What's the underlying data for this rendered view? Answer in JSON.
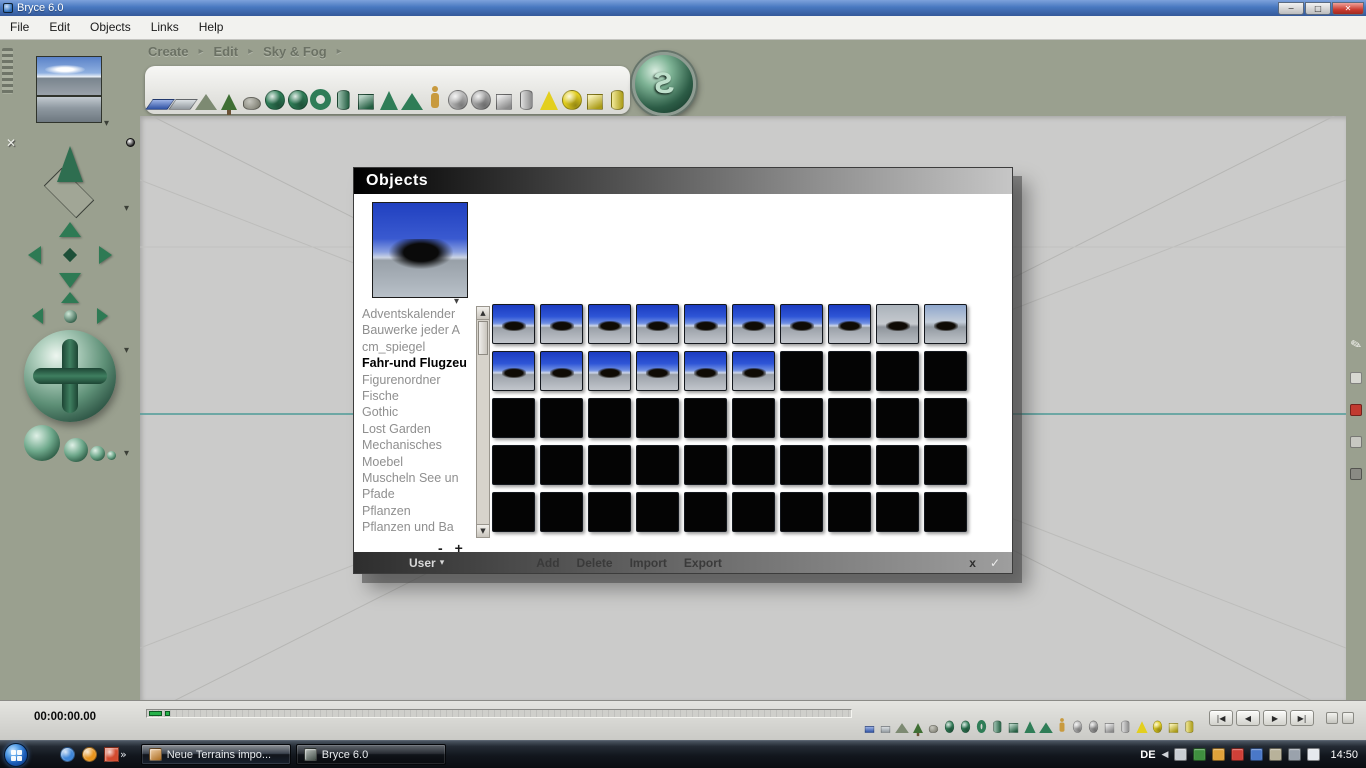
{
  "chrome": {
    "title": "Bryce 6.0",
    "window_buttons": [
      "−",
      "□",
      "✕"
    ],
    "menu": [
      "File",
      "Edit",
      "Objects",
      "Links",
      "Help"
    ],
    "mode_tabs": [
      "Create",
      "Edit",
      "Sky & Fog"
    ]
  },
  "glyphs": {
    "tab_arrow": "▸",
    "dropdown": "▾",
    "scroll_up": "▲",
    "scroll_down": "▼",
    "chevron_more": "»",
    "tray_chevron": "◀",
    "clear": "✕",
    "logo": "S"
  },
  "palette": {
    "icons": [
      {
        "name": "water-plane",
        "shape": "tile",
        "color": "#3a66cc"
      },
      {
        "name": "cloud-plane",
        "shape": "tile",
        "color": "#b6bfc6"
      },
      {
        "name": "terrain",
        "shape": "mountain",
        "color": "#7d8a72"
      },
      {
        "name": "tree",
        "shape": "tree",
        "color": "#3f6f34"
      },
      {
        "name": "rock",
        "shape": "rock",
        "color": "#8d8d7d"
      },
      {
        "name": "metaball",
        "shape": "sphere",
        "color": "#2f7d57"
      },
      {
        "name": "sphere",
        "shape": "sphere",
        "color": "#2f7d57"
      },
      {
        "name": "torus",
        "shape": "torus",
        "color": "#2f7d57"
      },
      {
        "name": "cylinder",
        "shape": "cylinder",
        "color": "#2f7d57"
      },
      {
        "name": "cube",
        "shape": "cube",
        "color": "#2f7d57"
      },
      {
        "name": "cone",
        "shape": "cone",
        "color": "#2f7d57"
      },
      {
        "name": "pyramid",
        "shape": "pyramid",
        "color": "#2f7d57"
      },
      {
        "name": "figure",
        "shape": "figure",
        "color": "#c89a3e"
      },
      {
        "name": "light-sphere",
        "shape": "sphere",
        "color": "#b9b9b9"
      },
      {
        "name": "light-dome",
        "shape": "sphere",
        "color": "#a6a6a6"
      },
      {
        "name": "light-cube",
        "shape": "cube",
        "color": "#b9b9b9"
      },
      {
        "name": "light-cylinder",
        "shape": "cylinder",
        "color": "#b9b9b9"
      },
      {
        "name": "spot-light",
        "shape": "cone",
        "color": "#e3cf1e"
      },
      {
        "name": "radial-light",
        "shape": "sphere",
        "color": "#e3cf1e"
      },
      {
        "name": "square-spot-light",
        "shape": "cube",
        "color": "#e3cf1e"
      },
      {
        "name": "parallel-light",
        "shape": "cylinder",
        "color": "#e3cf1e"
      }
    ]
  },
  "dialog": {
    "title": "Objects",
    "categories": [
      "Adventskalender",
      "Bauwerke jeder A",
      "cm_spiegel",
      "Fahr-und Flugzeu",
      "Figurenordner",
      "Fische",
      "Gothic",
      "Lost  Garden",
      "Mechanisches",
      "Moebel",
      "Muscheln See un",
      "Pfade",
      "Pflanzen",
      "Pflanzen und  Ba"
    ],
    "selected_index": 3,
    "zoom": {
      "minus": "-",
      "plus": "+"
    },
    "grid": {
      "cols": 10,
      "rows": [
        [
          {
            "n": "fighter-plane",
            "v": "sky"
          },
          {
            "n": "covered-wagon",
            "v": "sky"
          },
          {
            "n": "vintage-car",
            "v": "sky"
          },
          {
            "n": "hot-air-balloon",
            "v": "sky"
          },
          {
            "n": "barrel",
            "v": "sky"
          },
          {
            "n": "handcart",
            "v": "sky"
          },
          {
            "n": "seaplane",
            "v": "sky"
          },
          {
            "n": "sports-car",
            "v": "sky"
          },
          {
            "n": "gray-scene",
            "v": "gray"
          },
          {
            "n": "coast-scene",
            "v": "grayblue"
          }
        ],
        [
          {
            "n": "stagecoach",
            "v": "sky"
          },
          {
            "n": "fire-truck",
            "v": "sky"
          },
          {
            "n": "biplane",
            "v": "sky"
          },
          {
            "n": "glider",
            "v": "sky"
          },
          {
            "n": "buggy",
            "v": "sky"
          },
          {
            "n": "airplane",
            "v": "sky"
          },
          {
            "v": "empty"
          },
          {
            "v": "empty"
          },
          {
            "v": "empty"
          },
          {
            "v": "empty"
          }
        ],
        [
          {
            "v": "empty"
          },
          {
            "v": "empty"
          },
          {
            "v": "empty"
          },
          {
            "v": "empty"
          },
          {
            "v": "empty"
          },
          {
            "v": "empty"
          },
          {
            "v": "empty"
          },
          {
            "v": "empty"
          },
          {
            "v": "empty"
          },
          {
            "v": "empty"
          }
        ],
        [
          {
            "v": "empty"
          },
          {
            "v": "empty"
          },
          {
            "v": "empty"
          },
          {
            "v": "empty"
          },
          {
            "v": "empty"
          },
          {
            "v": "empty"
          },
          {
            "v": "empty"
          },
          {
            "v": "empty"
          },
          {
            "v": "empty"
          },
          {
            "v": "empty"
          }
        ],
        [
          {
            "v": "empty"
          },
          {
            "v": "empty"
          },
          {
            "v": "empty"
          },
          {
            "v": "empty"
          },
          {
            "v": "empty"
          },
          {
            "v": "empty"
          },
          {
            "v": "empty"
          },
          {
            "v": "empty"
          },
          {
            "v": "empty"
          },
          {
            "v": "empty"
          }
        ]
      ]
    },
    "footer": {
      "library_label": "User",
      "buttons": [
        "Add",
        "Delete",
        "Import",
        "Export"
      ],
      "cancel_label": "x",
      "ok_label": "✓"
    }
  },
  "timeline": {
    "timecode": "00:00:00.00"
  },
  "transport": {
    "buttons": [
      "|◀",
      "◀",
      "▶",
      "▶|"
    ]
  },
  "right_tools": [
    {
      "name": "pencil-icon",
      "glyph": "✎",
      "color": "#f2f2ee"
    },
    {
      "name": "eraser-icon",
      "color": "#d8d8d2",
      "box": true
    },
    {
      "name": "material-red-icon",
      "color": "#c23a30",
      "box": true
    },
    {
      "name": "swatch-gray-icon",
      "color": "#c8c8c2",
      "box": true
    },
    {
      "name": "swatch-dark-icon",
      "color": "#8a8a84",
      "box": true
    }
  ],
  "taskbar": {
    "quicklaunch": [
      {
        "name": "app-icon-blue",
        "color": "#3f86d8",
        "round": true
      },
      {
        "name": "app-icon-orange",
        "color": "#e8941e",
        "round": true
      },
      {
        "name": "app-icon-red",
        "color": "#d24a2e",
        "round": false
      }
    ],
    "tasks": [
      {
        "label": "Neue Terrains impo...",
        "icon": "terrain-document",
        "icon_color": "#d98a2b"
      },
      {
        "label": "Bryce 6.0",
        "icon": "bryce-app",
        "icon_color": "#55645c"
      }
    ],
    "language": "DE",
    "time": "14:50",
    "tray_icons": [
      {
        "name": "tablet-input-icon",
        "color": "#c9ced4"
      },
      {
        "name": "graphics-settings-icon",
        "color": "#3f8f3f"
      },
      {
        "name": "color-profile-icon",
        "color": "#e0a23a"
      },
      {
        "name": "antivirus-icon",
        "color": "#d04038"
      },
      {
        "name": "updater-icon",
        "color": "#4a78c8"
      },
      {
        "name": "clipboard-icon",
        "color": "#b8b29a"
      },
      {
        "name": "network-icon",
        "color": "#9aa2ac"
      },
      {
        "name": "volume-icon",
        "color": "#e6e9ee"
      }
    ]
  },
  "colors": {
    "chrome_olive": "#9aa08f",
    "canvas_gray": "#cbcbca",
    "horizon_teal": "#4e9b97",
    "accent_green": "#2f7d57",
    "thumbnail_sky_blue": "#2e55d6",
    "titlebar_blue": "#4878c0",
    "taskbar_dark": "#12161d",
    "light_yellow": "#e3cf1e"
  }
}
